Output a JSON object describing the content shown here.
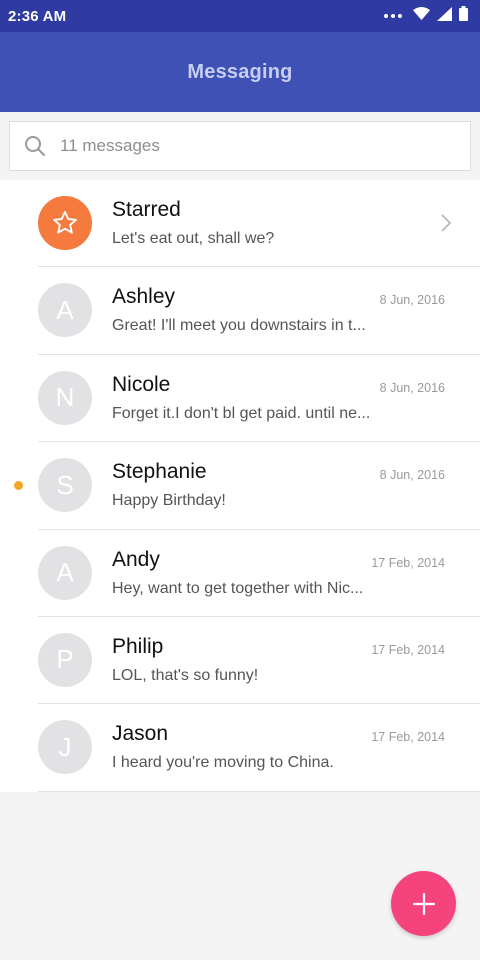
{
  "status_bar": {
    "time": "2:36 AM"
  },
  "app_bar": {
    "title": "Messaging"
  },
  "search": {
    "placeholder": "11 messages"
  },
  "colors": {
    "status_bar": "#2f3aa3",
    "app_bar": "#3f51b5",
    "starred_avatar": "#f47a3d",
    "unread_dot": "#f5a623",
    "fab": "#f5447d"
  },
  "conversations": [
    {
      "name": "Starred",
      "preview": "Let's eat out, shall we?",
      "date": "",
      "avatar": "star-icon"
    },
    {
      "name": "Ashley",
      "initial": "A",
      "preview": "Great! I'll meet you downstairs in t...",
      "date": "8 Jun, 2016"
    },
    {
      "name": "Nicole",
      "initial": "N",
      "preview": "Forget it.I don't bl get paid. until ne...",
      "date": "8 Jun, 2016"
    },
    {
      "name": "Stephanie",
      "initial": "S",
      "preview": "Happy Birthday!",
      "date": "8 Jun, 2016",
      "unread": true
    },
    {
      "name": "Andy",
      "initial": "A",
      "preview": "Hey, want to get together with Nic...",
      "date": "17 Feb, 2014"
    },
    {
      "name": "Philip",
      "initial": "P",
      "preview": "LOL, that's so funny!",
      "date": "17 Feb, 2014"
    },
    {
      "name": "Jason",
      "initial": "J",
      "preview": "I heard you're moving to China.",
      "date": "17 Feb, 2014"
    }
  ],
  "fab": {
    "icon": "plus-icon"
  }
}
